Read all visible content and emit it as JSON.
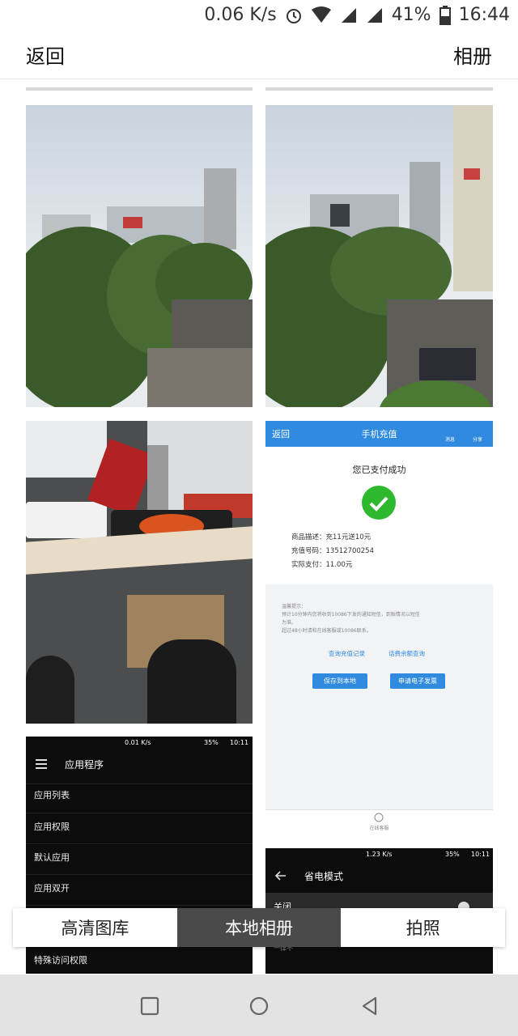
{
  "status": {
    "speed": "0.06 K/s",
    "battery": "41%",
    "time": "16:44"
  },
  "header": {
    "back": "返回",
    "album": "相册"
  },
  "tabs": [
    {
      "label": "高清图库",
      "active": false
    },
    {
      "label": "本地相册",
      "active": true
    },
    {
      "label": "拍照",
      "active": false
    }
  ],
  "payment_screen": {
    "back": "返回",
    "title": "手机充值",
    "msg_label": "消息",
    "share_label": "分享",
    "success": "您已支付成功",
    "desc_line": "商品描述：充11元送10元",
    "number_line": "充值号码：13512700254",
    "paid_line": "实际支付：11.00元",
    "tip_title": "温馨提示：",
    "tip_line1": "预计10分钟内您将收到10086下发的通知短信，到账情况以短信",
    "tip_line2": "为准。",
    "tip_line3": "超过48小时请和在线客服或10086联系。",
    "link1": "查询充值记录",
    "link2": "话费余额查询",
    "btn_save": "保存到本地",
    "btn_invoice": "申请电子发票",
    "service": "在线客服"
  },
  "apps_screen": {
    "speed": "0.01 K/s",
    "battery": "35%",
    "time": "10:11",
    "title": "应用程序",
    "items": [
      "应用列表",
      "应用权限",
      "默认应用",
      "应用双开",
      "特殊访问权限"
    ]
  },
  "power_screen": {
    "speed": "1.23 K/s",
    "battery": "35%",
    "time": "10:11",
    "title": "省电模式",
    "row1": "关闭",
    "row2": "一律不"
  }
}
